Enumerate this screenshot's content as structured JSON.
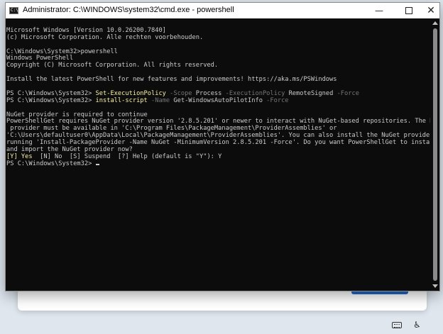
{
  "window": {
    "title": "Administrator: C:\\WINDOWS\\system32\\cmd.exe - powershell",
    "icon_label": "C:\\",
    "controls": {
      "minimize": "—",
      "close": "✕"
    }
  },
  "console": {
    "l1": "Microsoft Windows [Version 10.0.26200.7840]",
    "l2": "(c) Microsoft Corporation. Alle rechten voorbehouden.",
    "l3": "C:\\Windows\\System32>powershell",
    "l4": "Windows PowerShell",
    "l5": "Copyright (C) Microsoft Corporation. All rights reserved.",
    "l6": "Install the latest PowerShell for new features and improvements! https://aka.ms/PSWindows",
    "prompt": "PS C:\\Windows\\System32> ",
    "cmd1": {
      "name": "Set-ExecutionPolicy",
      "p1": "-Scope",
      "v1": "Process",
      "p2": "-ExecutionPolicy",
      "v2": "RemoteSigned",
      "p3": "-Force"
    },
    "cmd2": {
      "name": "install-script",
      "p1": "-Name",
      "v1": "Get-WindowsAutoPilotInfo",
      "p2": "-Force"
    },
    "n1": "NuGet provider is required to continue",
    "n2": "PowerShellGet requires NuGet provider version '2.8.5.201' or newer to interact with NuGet-based repositories. The NuGet",
    "n3": " provider must be available in 'C:\\Program Files\\PackageManagement\\ProviderAssemblies' or",
    "n4": "'C:\\Users\\defaultuser0\\AppData\\Local\\PackageManagement\\ProviderAssemblies'. You can also install the NuGet provider by",
    "n5": "running 'Install-PackageProvider -Name NuGet -MinimumVersion 2.8.5.201 -Force'. Do you want PowerShellGet to install",
    "n6": "and import the NuGet provider now?",
    "choice_yes": "[Y] Yes",
    "choice_rest": "  [N] No  [S] Suspend  [?] Help (default is \"Y\"): Y",
    "last_prompt": "PS C:\\Windows\\System32> "
  },
  "colors": {
    "console_bg": "#0c0c0c",
    "console_text": "#cccccc",
    "cmdlet": "#f9f1a5",
    "parameter": "#767676",
    "accent_button": "#1f67c8"
  },
  "icons": [
    "cmd-icon",
    "minimize-icon",
    "maximize-icon",
    "close-icon",
    "keyboard-icon",
    "accessibility-icon"
  ]
}
